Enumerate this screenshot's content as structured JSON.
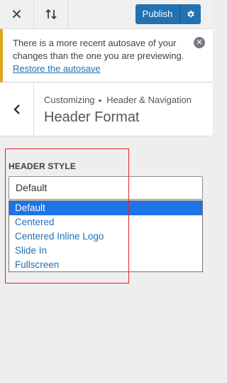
{
  "topbar": {
    "close_icon": "close-icon",
    "device_icon": "sort-arrows-icon",
    "publish_label": "Publish",
    "settings_icon": "gear-icon"
  },
  "notice": {
    "text": "There is a more recent autosave of your changes than the one you are previewing.",
    "link_label": "Restore the autosave",
    "dismiss_icon": "dismiss-icon",
    "accent_color": "#dba617"
  },
  "section": {
    "back_icon": "chevron-left-icon",
    "breadcrumb_root": "Customizing",
    "breadcrumb_separator": "▸",
    "breadcrumb_parent": "Header & Navigation",
    "title": "Header Format"
  },
  "control": {
    "label": "HEADER STYLE",
    "selected_value": "Default",
    "options": [
      "Default",
      "Centered",
      "Centered Inline Logo",
      "Slide In",
      "Fullscreen"
    ],
    "highlighted_option": "Default"
  },
  "colors": {
    "primary": "#2271b1",
    "selection": "#1e73e8",
    "annotation": "#e0242a"
  }
}
